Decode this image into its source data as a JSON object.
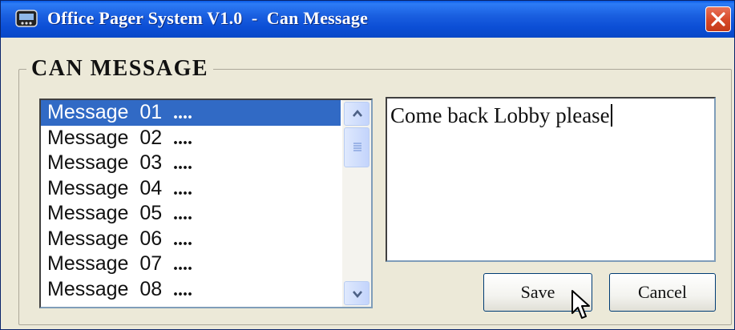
{
  "window": {
    "title": "Office Pager System V1.0  -  Can Message",
    "icon": "pager-app-icon",
    "close_icon": "close-icon"
  },
  "group": {
    "title": "CAN MESSAGE"
  },
  "messages": {
    "items": [
      {
        "label": "Message  01  ",
        "dots": "...."
      },
      {
        "label": "Message  02  ",
        "dots": "...."
      },
      {
        "label": "Message  03  ",
        "dots": "...."
      },
      {
        "label": "Message  04  ",
        "dots": "...."
      },
      {
        "label": "Message  05  ",
        "dots": "...."
      },
      {
        "label": "Message  06  ",
        "dots": "...."
      },
      {
        "label": "Message  07  ",
        "dots": "...."
      },
      {
        "label": "Message  08  ",
        "dots": "...."
      }
    ],
    "selected_index": 0
  },
  "editor": {
    "value": "Come back Lobby please"
  },
  "buttons": {
    "save_label": "Save",
    "cancel_label": "Cancel"
  },
  "colors": {
    "titlebar": "#0c4fd6",
    "selection": "#316ac5",
    "close": "#d84a2a",
    "face": "#ece9d8"
  }
}
